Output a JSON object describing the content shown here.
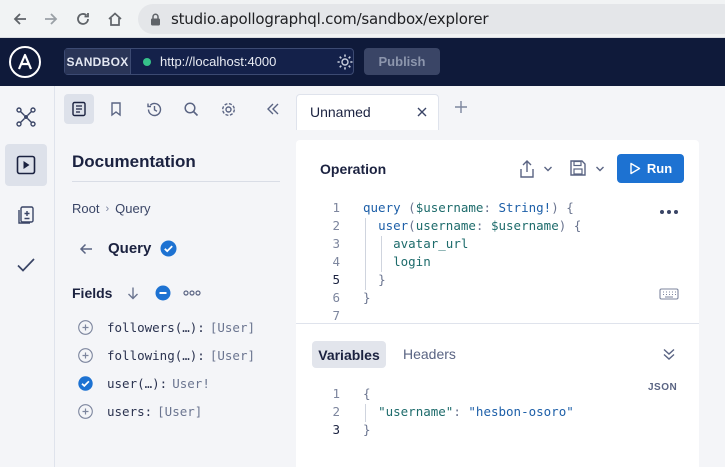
{
  "browser": {
    "url": "studio.apollographql.com/sandbox/explorer"
  },
  "topbar": {
    "sandbox_tag": "SANDBOX",
    "endpoint": "http://localhost:4000",
    "publish_label": "Publish"
  },
  "docs": {
    "title": "Documentation",
    "breadcrumb": [
      "Root",
      "Query"
    ],
    "query_name": "Query",
    "fields_label": "Fields",
    "fields": [
      {
        "name": "followers(…):",
        "type": "[User]",
        "selected": false
      },
      {
        "name": "following(…):",
        "type": "[User]",
        "selected": false
      },
      {
        "name": "user(…):",
        "type": "User!",
        "selected": true
      },
      {
        "name": "users:",
        "type": "[User]",
        "selected": false
      }
    ]
  },
  "tabs": {
    "active_label": "Unnamed"
  },
  "operation": {
    "title": "Operation",
    "run_label": "Run",
    "line_numbers": [
      "1",
      "2",
      "3",
      "4",
      "5",
      "6",
      "7"
    ]
  },
  "variables": {
    "tab_label": "Variables",
    "headers_label": "Headers",
    "format_label": "JSON",
    "line_numbers": [
      "1",
      "2",
      "3"
    ],
    "key": "\"username\"",
    "value": "\"hesbon-osoro\""
  },
  "colors": {
    "topbar_bg": "#0f1a3a",
    "run_button": "#1d72d2",
    "status_dot": "#36c28a",
    "check_blue": "#1d72d2"
  }
}
